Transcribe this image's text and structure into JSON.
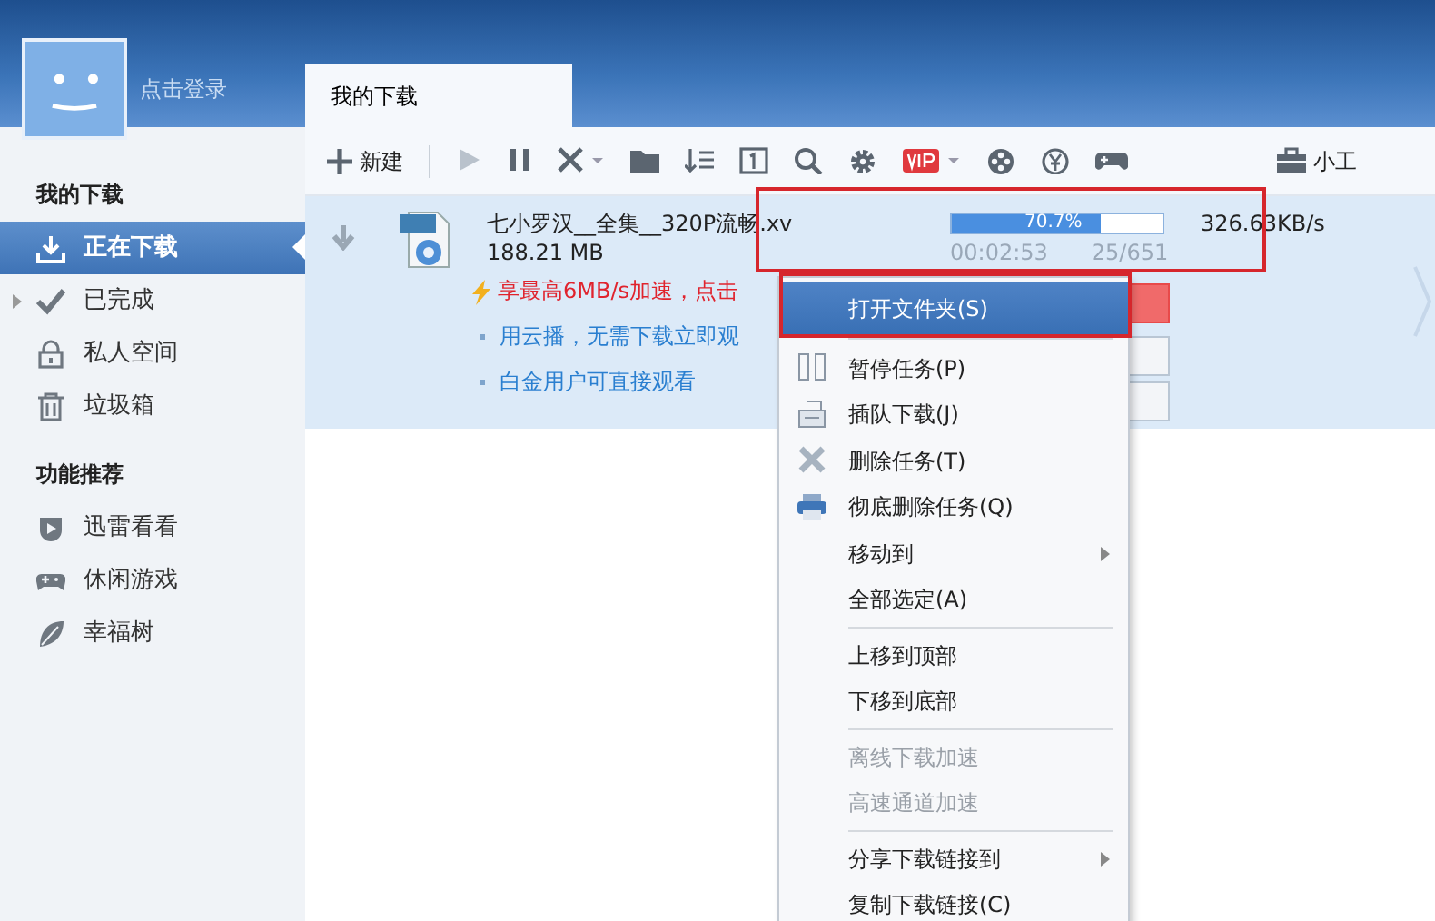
{
  "header": {
    "login": "点击登录"
  },
  "tabs": [
    {
      "label": "我的下载",
      "selected": true
    }
  ],
  "toolbar": {
    "new_button": "新建",
    "right_button": "小工"
  },
  "sidebar": [
    {
      "heading": "我的下载",
      "items": [
        {
          "label": "正在下载",
          "selected": true
        },
        {
          "label": "已完成",
          "selected": false,
          "expanded": false
        },
        {
          "label": "私人空间",
          "selected": false
        },
        {
          "label": "垃圾箱",
          "selected": false
        }
      ]
    },
    {
      "heading": "功能推荐",
      "items": [
        {
          "label": "迅雷看看",
          "selected": false
        },
        {
          "label": "休闲游戏",
          "selected": false
        },
        {
          "label": "幸福树",
          "selected": false
        }
      ]
    }
  ],
  "task": {
    "selected": true,
    "name": "七小罗汉__全集__320P流畅.xv",
    "size": "188.21 MB",
    "progress_text": "70.7%",
    "level": 0.707,
    "speed": "326.63KB/s",
    "time": "00:02:53",
    "count": "25/651",
    "promo": "享最高6MB/s加速，点击",
    "hints": [
      "用云播，无需下载立即观",
      "白金用户可直接观看"
    ]
  },
  "context_menu": [
    {
      "kind": "item",
      "label": "打开文件夹(S)",
      "selected": true,
      "disabled": false
    },
    {
      "kind": "separator"
    },
    {
      "kind": "item",
      "label": "暂停任务(P)",
      "selected": false,
      "disabled": false
    },
    {
      "kind": "item",
      "label": "插队下载(J)",
      "selected": false,
      "disabled": false
    },
    {
      "kind": "item",
      "label": "删除任务(T)",
      "selected": false,
      "disabled": false
    },
    {
      "kind": "item",
      "label": "彻底删除任务(Q)",
      "selected": false,
      "disabled": false
    },
    {
      "kind": "submenu",
      "label": "移动到",
      "selected": false,
      "disabled": false
    },
    {
      "kind": "item",
      "label": "全部选定(A)",
      "selected": false,
      "disabled": false
    },
    {
      "kind": "separator"
    },
    {
      "kind": "item",
      "label": "上移到顶部",
      "selected": false,
      "disabled": false
    },
    {
      "kind": "item",
      "label": "下移到底部",
      "selected": false,
      "disabled": false
    },
    {
      "kind": "separator"
    },
    {
      "kind": "item",
      "label": "离线下载加速",
      "selected": false,
      "disabled": true
    },
    {
      "kind": "item",
      "label": "高速通道加速",
      "selected": false,
      "disabled": true
    },
    {
      "kind": "separator"
    },
    {
      "kind": "submenu",
      "label": "分享下载链接到",
      "selected": false,
      "disabled": false
    },
    {
      "kind": "item",
      "label": "复制下载链接(C)",
      "selected": false,
      "disabled": false
    }
  ]
}
